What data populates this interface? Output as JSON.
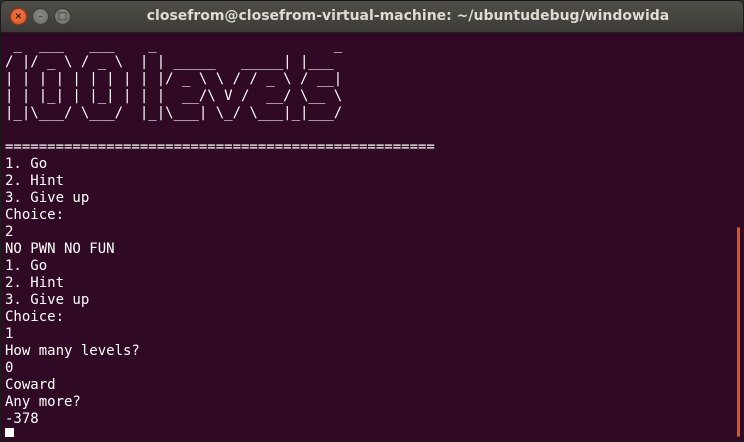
{
  "window": {
    "title": "closefrom@closefrom-virtual-machine: ~/ubuntudebug/windowida"
  },
  "controls": {
    "close_glyph": "×",
    "minimize_glyph": "–",
    "maximize_glyph": "□"
  },
  "terminal": {
    "banner": [
      " _  ___   ___    _                     _",
      "/ |/ _ \\ / _ \\  | | _____   _____| |___",
      "| | | | | | | | | |/ _ \\ \\ / / _ \\ / __|",
      "| | |_| | |_| | | |  __/\\ V /  __/ \\__ \\",
      "|_|\\___/ \\___/  |_|\\___| \\_/ \\___|_|___/"
    ],
    "separator": "===================================================",
    "lines": [
      "1. Go",
      "2. Hint",
      "3. Give up",
      "Choice:",
      "2",
      "NO PWN NO FUN",
      "1. Go",
      "2. Hint",
      "3. Give up",
      "Choice:",
      "1",
      "How many levels?",
      "0",
      "Coward",
      "Any more?",
      "-378"
    ]
  },
  "colors": {
    "terminal_bg": "#300a24",
    "terminal_fg": "#ffffff",
    "titlebar_bg": "#3c3b37",
    "close_button": "#e0531d"
  }
}
